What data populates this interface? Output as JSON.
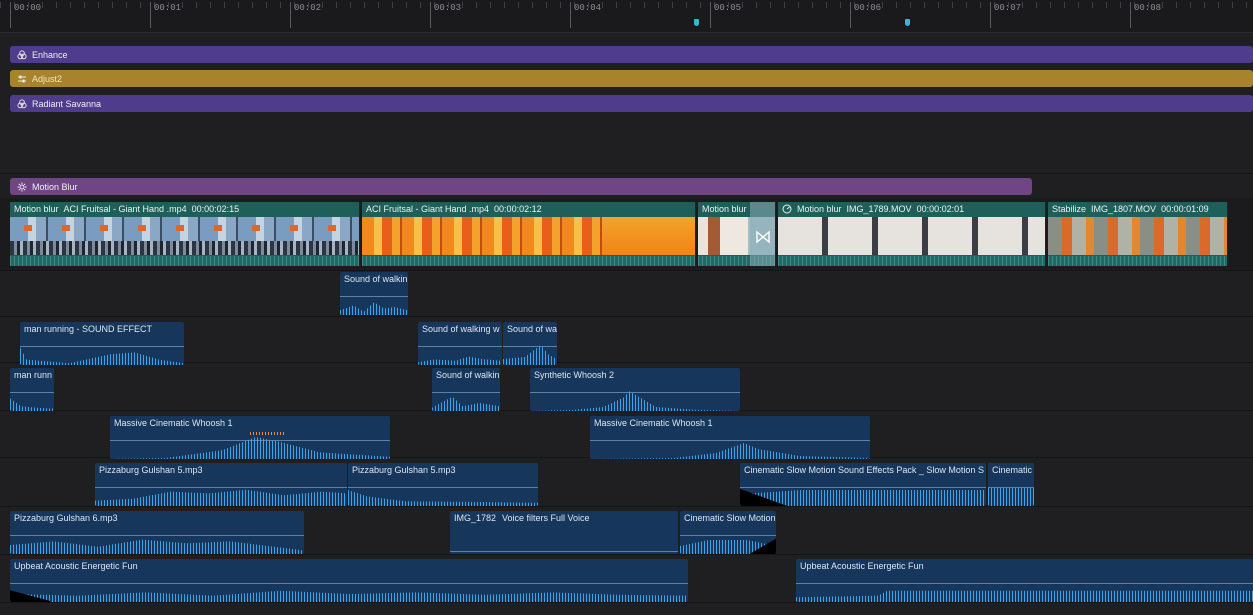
{
  "ruler": {
    "ticks": [
      "00:00",
      "00:01",
      "00:02",
      "00:03",
      "00:04",
      "00:05",
      "00:06",
      "00:07",
      "00:08"
    ],
    "marker_color": "#35b7d6"
  },
  "effect_tracks": {
    "enhance": {
      "label": "Enhance",
      "color": "#4f3c8c",
      "icon": "effect-icon"
    },
    "adjust": {
      "label": "Adjust2",
      "color": "#a7832d",
      "icon": "sliders-icon"
    },
    "radiant": {
      "label": "Radiant Savanna",
      "color": "#4f3c8c",
      "icon": "effect-icon"
    },
    "motion_blur": {
      "label": "Motion Blur",
      "color": "#6f4585",
      "icon": "gear-effect-icon"
    }
  },
  "video_clips": [
    {
      "effect": "Motion blur",
      "name": "ACI Fruitsal - Giant Hand .mp4",
      "duration": "00:00:02:15"
    },
    {
      "effect": "",
      "name": "ACI Fruitsal - Giant Hand .mp4",
      "duration": "00:00:02:12"
    },
    {
      "effect": "Motion blur",
      "name": "",
      "duration": ""
    },
    {
      "effect": "Motion blur",
      "name": "IMG_1789.MOV",
      "duration": "00:00:02:01"
    },
    {
      "effect": "Stabilize",
      "name": "IMG_1807.MOV",
      "duration": "00:00:01:09"
    }
  ],
  "audio_clips": [
    "Sound of walkin",
    "man running - SOUND EFFECT",
    "Sound of walking w",
    "Sound of wa",
    "man runn",
    "Sound of walkin",
    "Synthetic Whoosh 2",
    "Massive Cinematic Whoosh 1",
    "Massive Cinematic Whoosh 1",
    "Pizzaburg Gulshan 5.mp3",
    "Pizzaburg Gulshan 5.mp3",
    "Cinematic Slow Motion Sound Effects Pack _ Slow Motion S",
    "Cinematic",
    "Pizzaburg Gulshan 6.mp3",
    "IMG_1782",
    "Voice filters Full Voice",
    "Cinematic Slow Motion",
    "Upbeat Acoustic Energetic Fun",
    "Upbeat Acoustic Energetic Fun"
  ]
}
